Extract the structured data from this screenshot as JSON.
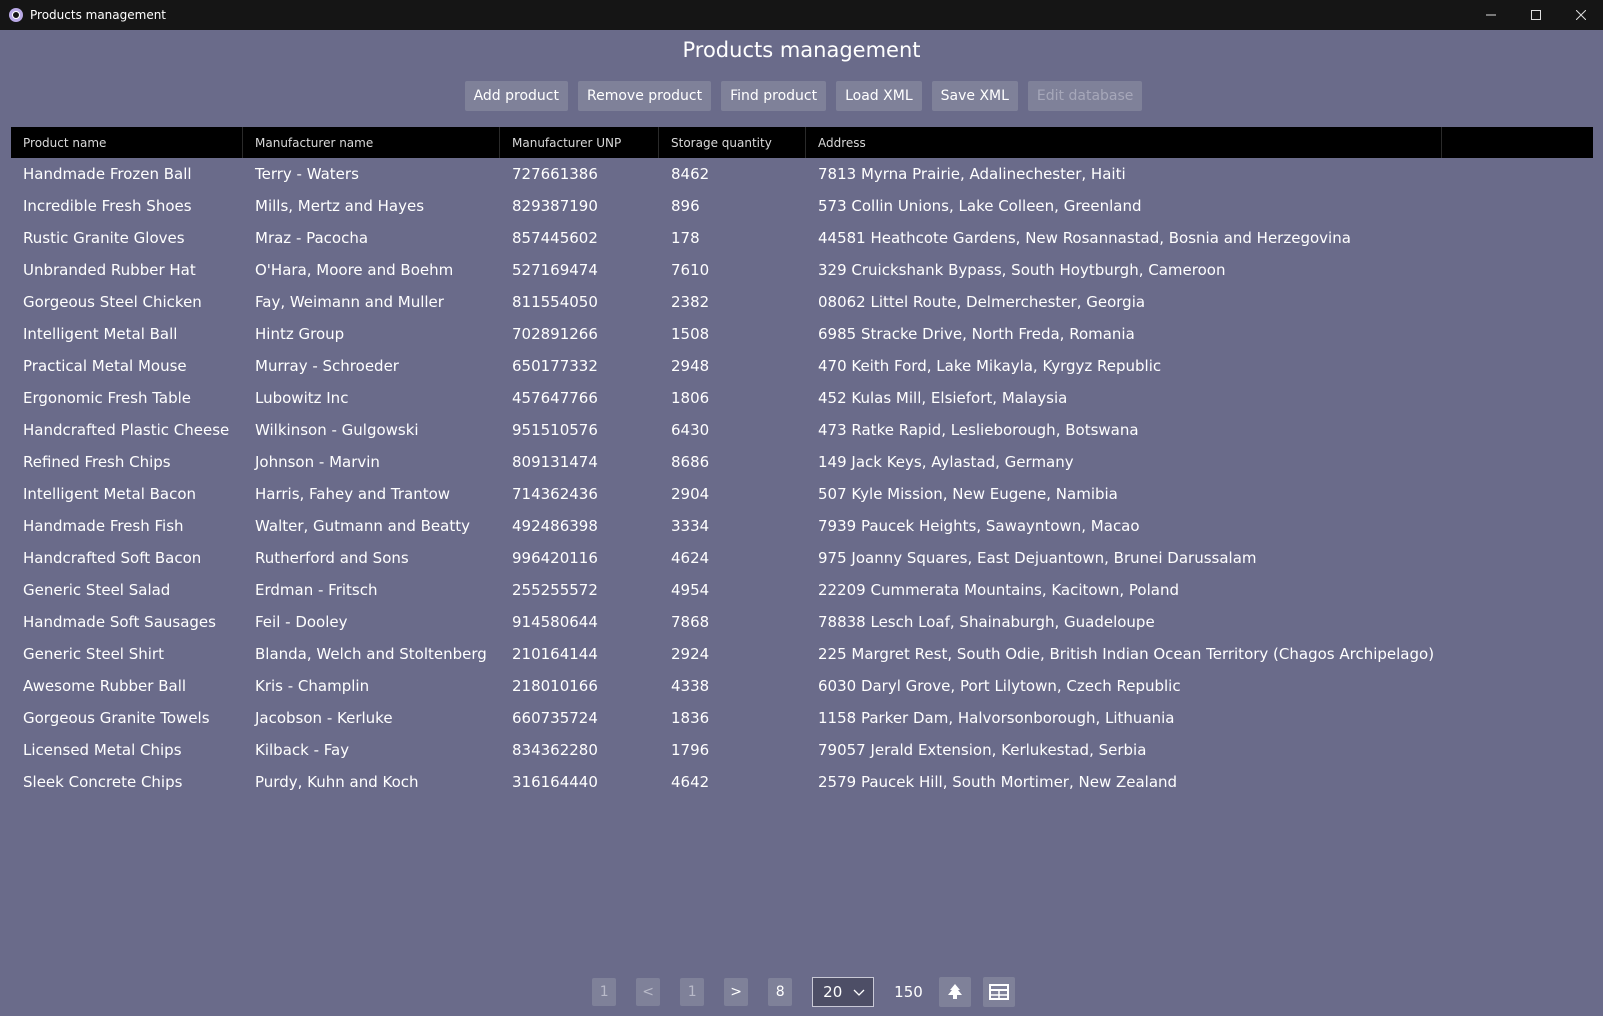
{
  "window": {
    "title": "Products management",
    "controls": {
      "minimize": "—",
      "maximize": "☐",
      "close": "✕"
    }
  },
  "page_title": "Products management",
  "toolbar": {
    "add": "Add product",
    "remove": "Remove product",
    "find": "Find product",
    "load": "Load XML",
    "save": "Save XML",
    "edit": "Edit database"
  },
  "table": {
    "headers": [
      "Product name",
      "Manufacturer name",
      "Manufacturer UNP",
      "Storage quantity",
      "Address",
      ""
    ],
    "rows": [
      [
        "Handmade Frozen Ball",
        "Terry - Waters",
        "727661386",
        "8462",
        "7813 Myrna Prairie, Adalinechester, Haiti"
      ],
      [
        "Incredible Fresh Shoes",
        "Mills, Mertz and Hayes",
        "829387190",
        "896",
        "573 Collin Unions, Lake Colleen, Greenland"
      ],
      [
        "Rustic Granite Gloves",
        "Mraz - Pacocha",
        "857445602",
        "178",
        "44581 Heathcote Gardens, New Rosannastad, Bosnia and Herzegovina"
      ],
      [
        "Unbranded Rubber Hat",
        "O'Hara, Moore and Boehm",
        "527169474",
        "7610",
        "329 Cruickshank Bypass, South Hoytburgh, Cameroon"
      ],
      [
        "Gorgeous Steel Chicken",
        "Fay, Weimann and Muller",
        "811554050",
        "2382",
        "08062 Littel Route, Delmerchester, Georgia"
      ],
      [
        "Intelligent Metal Ball",
        "Hintz Group",
        "702891266",
        "1508",
        "6985 Stracke Drive, North Freda, Romania"
      ],
      [
        "Practical Metal Mouse",
        "Murray - Schroeder",
        "650177332",
        "2948",
        "470 Keith Ford, Lake Mikayla, Kyrgyz Republic"
      ],
      [
        "Ergonomic Fresh Table",
        "Lubowitz Inc",
        "457647766",
        "1806",
        "452 Kulas Mill, Elsiefort, Malaysia"
      ],
      [
        "Handcrafted Plastic Cheese",
        "Wilkinson - Gulgowski",
        "951510576",
        "6430",
        "473 Ratke Rapid, Leslieborough, Botswana"
      ],
      [
        "Refined Fresh Chips",
        "Johnson - Marvin",
        "809131474",
        "8686",
        "149 Jack Keys, Aylastad, Germany"
      ],
      [
        "Intelligent Metal Bacon",
        "Harris, Fahey and Trantow",
        "714362436",
        "2904",
        "507 Kyle Mission, New Eugene, Namibia"
      ],
      [
        "Handmade Fresh Fish",
        "Walter, Gutmann and Beatty",
        "492486398",
        "3334",
        "7939 Paucek Heights, Sawayntown, Macao"
      ],
      [
        "Handcrafted Soft Bacon",
        "Rutherford and Sons",
        "996420116",
        "4624",
        "975 Joanny Squares, East Dejuantown, Brunei Darussalam"
      ],
      [
        "Generic Steel Salad",
        "Erdman - Fritsch",
        "255255572",
        "4954",
        "22209 Cummerata Mountains, Kacitown, Poland"
      ],
      [
        "Handmade Soft Sausages",
        "Feil - Dooley",
        "914580644",
        "7868",
        "78838 Lesch Loaf, Shainaburgh, Guadeloupe"
      ],
      [
        "Generic Steel Shirt",
        "Blanda, Welch and Stoltenberg",
        "210164144",
        "2924",
        "225 Margret Rest, South Odie, British Indian Ocean Territory (Chagos Archipelago)"
      ],
      [
        "Awesome Rubber Ball",
        "Kris - Champlin",
        "218010166",
        "4338",
        "6030 Daryl Grove, Port Lilytown, Czech Republic"
      ],
      [
        "Gorgeous Granite Towels",
        "Jacobson - Kerluke",
        "660735724",
        "1836",
        "1158 Parker Dam, Halvorsonborough, Lithuania"
      ],
      [
        "Licensed Metal Chips",
        "Kilback - Fay",
        "834362280",
        "1796",
        "79057 Jerald Extension, Kerlukestad, Serbia"
      ],
      [
        "Sleek Concrete Chips",
        "Purdy, Kuhn and Koch",
        "316164440",
        "4642",
        "2579 Paucek Hill, South Mortimer, New Zealand"
      ]
    ]
  },
  "pagination": {
    "first": "1",
    "prev": "<",
    "current": "1",
    "next": ">",
    "last": "8",
    "page_size": "20",
    "total": "150"
  },
  "icons": {
    "tree_view": "tree-icon",
    "table_view": "table-icon"
  }
}
